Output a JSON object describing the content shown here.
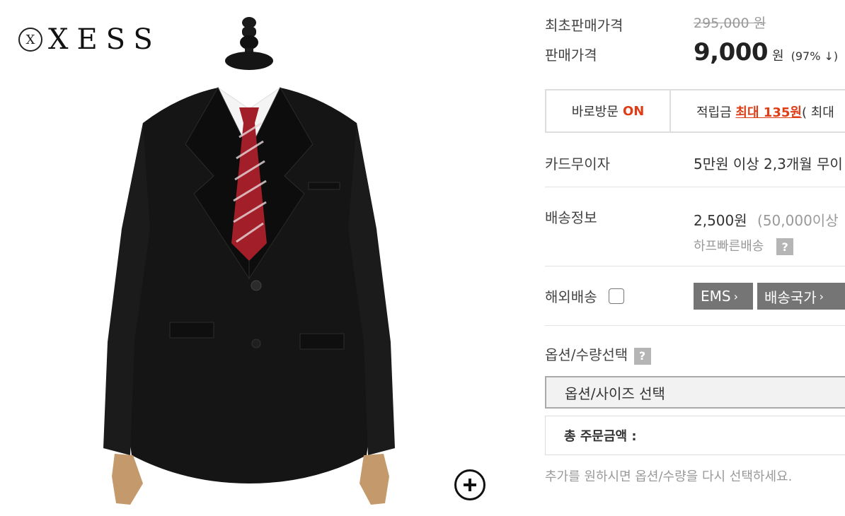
{
  "brand": {
    "name": "XESS",
    "mark": "X"
  },
  "price": {
    "original_label": "최초판매가격",
    "original_value": "295,000 원",
    "sale_label": "판매가격",
    "sale_value": "9,000",
    "sale_unit": "원",
    "discount": "(97% ↓)"
  },
  "visit": {
    "label": "바로방문",
    "status": "ON",
    "points_label": "적립금",
    "points_value": "최대 135원",
    "points_suffix": "( 최대"
  },
  "card": {
    "label": "카드무이자",
    "value": "5만원 이상 2,3개월 무이"
  },
  "shipping": {
    "label": "배송정보",
    "fee": "2,500원",
    "condition": "(50,000이상",
    "method": "하프빠른배송"
  },
  "overseas": {
    "label": "해외배송",
    "ems_button": "EMS",
    "countries_button": "배송국가"
  },
  "options": {
    "label": "옵션/수량선택",
    "select_placeholder": "옵션/사이즈 선택",
    "total_label": "총 주문금액 :",
    "note": "추가를 원하시면 옵션/수량을 다시 선택하세요."
  },
  "icons": {
    "help": "?",
    "chevron": "›"
  },
  "colors": {
    "accent": "#e03c16",
    "button_gray": "#757575",
    "help_gray": "#b5b5b5"
  }
}
